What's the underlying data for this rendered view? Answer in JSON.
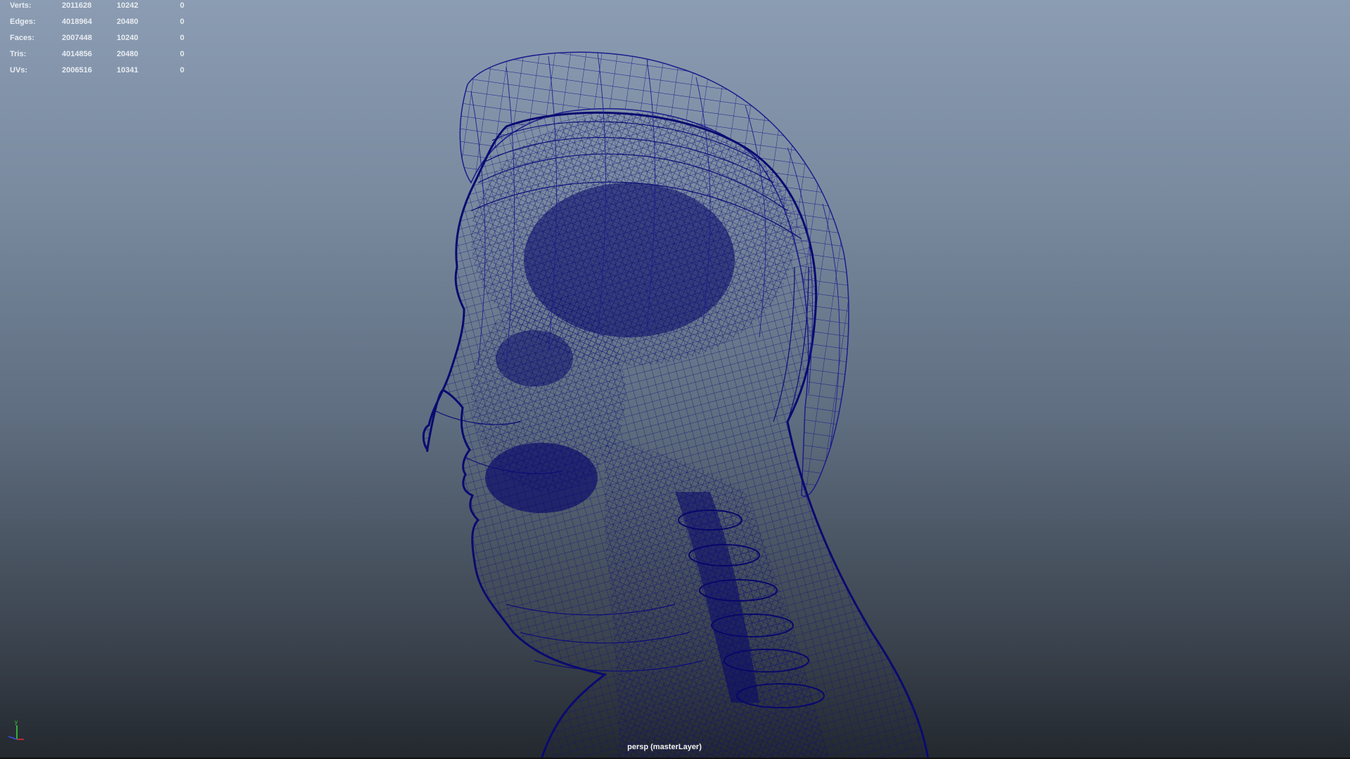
{
  "hud": {
    "rows": [
      {
        "label": "Verts:",
        "v1": "2011628",
        "v2": "10242",
        "v3": "0"
      },
      {
        "label": "Edges:",
        "v1": "4018964",
        "v2": "20480",
        "v3": "0"
      },
      {
        "label": "Faces:",
        "v1": "2007448",
        "v2": "10240",
        "v3": "0"
      },
      {
        "label": "Tris:",
        "v1": "4014856",
        "v2": "20480",
        "v3": "0"
      },
      {
        "label": "UVs:",
        "v1": "2006516",
        "v2": "10341",
        "v3": "0"
      }
    ]
  },
  "viewport": {
    "camera_label": "persp (masterLayer)",
    "wireframe_color": "#0a0a6e",
    "background_top": "#8b9cb3",
    "background_bottom": "#23282e",
    "axis_y_label": "y"
  },
  "icons": {
    "axis_gizmo": "axis-gizmo-icon"
  }
}
